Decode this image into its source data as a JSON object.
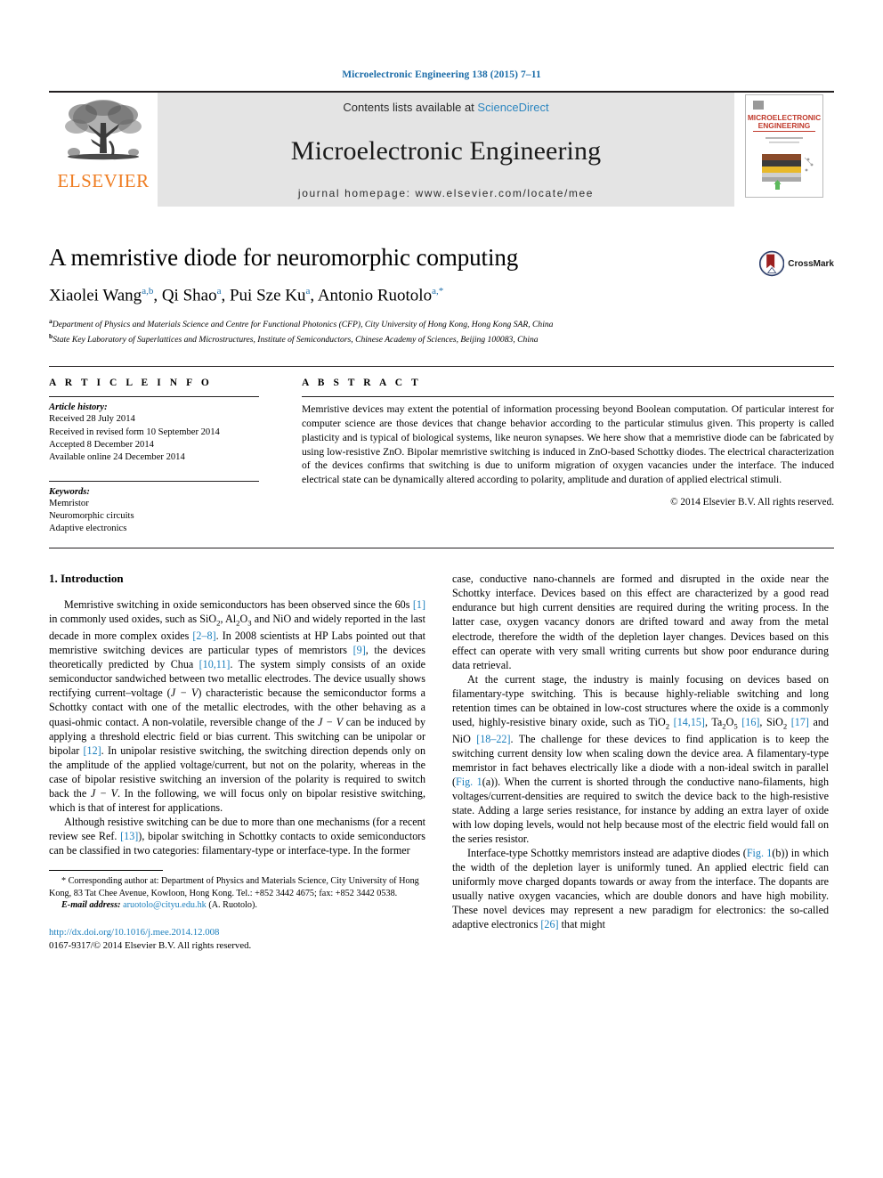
{
  "running_head": "Microelectronic Engineering 138 (2015) 7–11",
  "masthead": {
    "publisher_name": "ELSEVIER",
    "contents_prefix": "Contents lists available at ",
    "contents_link": "ScienceDirect",
    "journal_title": "Microelectronic Engineering",
    "homepage": "journal homepage: www.elsevier.com/locate/mee",
    "cover_title_line1": "MICROELECTRONIC",
    "cover_title_line2": "ENGINEERING",
    "accent_orange": "#ef7d22",
    "accent_blue": "#1b7fbd",
    "banner_grey": "#e4e4e4"
  },
  "article": {
    "title": "A memristive diode for neuromorphic computing",
    "authors": [
      {
        "name": "Xiaolei Wang",
        "marks": "a,b"
      },
      {
        "name": "Qi Shao",
        "marks": "a"
      },
      {
        "name": "Pui Sze Ku",
        "marks": "a"
      },
      {
        "name": "Antonio Ruotolo",
        "marks": "a,*"
      }
    ],
    "affiliations": [
      {
        "mark": "a",
        "text": "Department of Physics and Materials Science and Centre for Functional Photonics (CFP), City University of Hong Kong, Hong Kong SAR, China"
      },
      {
        "mark": "b",
        "text": "State Key Laboratory of Superlattices and Microstructures, Institute of Semiconductors, Chinese Academy of Sciences, Beijing 100083, China"
      }
    ],
    "crossmark_label": "CrossMark"
  },
  "article_info": {
    "heading": "A R T I C L E    I N F O",
    "history_label": "Article history:",
    "history": [
      "Received 28 July 2014",
      "Received in revised form 10 September 2014",
      "Accepted 8 December 2014",
      "Available online 24 December 2014"
    ],
    "keywords_label": "Keywords:",
    "keywords": [
      "Memristor",
      "Neuromorphic circuits",
      "Adaptive electronics"
    ]
  },
  "abstract": {
    "heading": "A B S T R A C T",
    "text": "Memristive devices may extent the potential of information processing beyond Boolean computation. Of particular interest for computer science are those devices that change behavior according to the particular stimulus given. This property is called plasticity and is typical of biological systems, like neuron synapses. We here show that a memristive diode can be fabricated by using low-resistive ZnO. Bipolar memristive switching is induced in ZnO-based Schottky diodes. The electrical characterization of the devices confirms that switching is due to uniform migration of oxygen vacancies under the interface. The induced electrical state can be dynamically altered according to polarity, amplitude and duration of applied electrical stimuli.",
    "copyright": "© 2014 Elsevier B.V. All rights reserved."
  },
  "body": {
    "section_heading": "1. Introduction",
    "left_paragraphs": [
      "Memristive switching in oxide semiconductors has been observed since the 60s [1] in commonly used oxides, such as SiO2, Al2O3 and NiO and widely reported in the last decade in more complex oxides [2–8]. In 2008 scientists at HP Labs pointed out that memristive switching devices are particular types of memristors [9], the devices theoretically predicted by Chua [10,11]. The system simply consists of an oxide semiconductor sandwiched between two metallic electrodes. The device usually shows rectifying current–voltage (J − V) characteristic because the semiconductor forms a Schottky contact with one of the metallic electrodes, with the other behaving as a quasi-ohmic contact. A non-volatile, reversible change of the J − V can be induced by applying a threshold electric field or bias current. This switching can be unipolar or bipolar [12]. In unipolar resistive switching, the switching direction depends only on the amplitude of the applied voltage/current, but not on the polarity, whereas in the case of bipolar resistive switching an inversion of the polarity is required to switch back the J − V. In the following, we will focus only on bipolar resistive switching, which is that of interest for applications.",
      "Although resistive switching can be due to more than one mechanisms (for a recent review see Ref. [13]), bipolar switching in Schottky contacts to oxide semiconductors can be classified in two categories: filamentary-type or interface-type. In the former"
    ],
    "right_paragraphs": [
      "case, conductive nano-channels are formed and disrupted in the oxide near the Schottky interface. Devices based on this effect are characterized by a good read endurance but high current densities are required during the writing process. In the latter case, oxygen vacancy donors are drifted toward and away from the metal electrode, therefore the width of the depletion layer changes. Devices based on this effect can operate with very small writing currents but show poor endurance during data retrieval.",
      "At the current stage, the industry is mainly focusing on devices based on filamentary-type switching. This is because highly-reliable switching and long retention times can be obtained in low-cost structures where the oxide is a commonly used, highly-resistive binary oxide, such as TiO2 [14,15], Ta2O5 [16], SiO2 [17] and NiO [18–22]. The challenge for these devices to find application is to keep the switching current density low when scaling down the device area. A filamentary-type memristor in fact behaves electrically like a diode with a non-ideal switch in parallel (Fig. 1(a)). When the current is shorted through the conductive nano-filaments, high voltages/current-densities are required to switch the device back to the high-resistive state. Adding a large series resistance, for instance by adding an extra layer of oxide with low doping levels, would not help because most of the electric field would fall on the series resistor.",
      "Interface-type Schottky memristors instead are adaptive diodes (Fig. 1(b)) in which the width of the depletion layer is uniformly tuned. An applied electric field can uniformly move charged dopants towards or away from the interface. The dopants are usually native oxygen vacancies, which are double donors and have high mobility. These novel devices may represent a new paradigm for electronics: the so-called adaptive electronics [26] that might"
    ]
  },
  "footnotes": {
    "corresponding_marker": "*",
    "corresponding_text": "Corresponding author at: Department of Physics and Materials Science, City University of Hong Kong, 83 Tat Chee Avenue, Kowloon, Hong Kong. Tel.: +852 3442 4675; fax: +852 3442 0538.",
    "email_label": "E-mail address:",
    "email": "aruotolo@cityu.edu.hk",
    "email_suffix": "(A. Ruotolo)."
  },
  "footer": {
    "doi": "http://dx.doi.org/10.1016/j.mee.2014.12.008",
    "issn_line": "0167-9317/© 2014 Elsevier B.V. All rights reserved."
  }
}
